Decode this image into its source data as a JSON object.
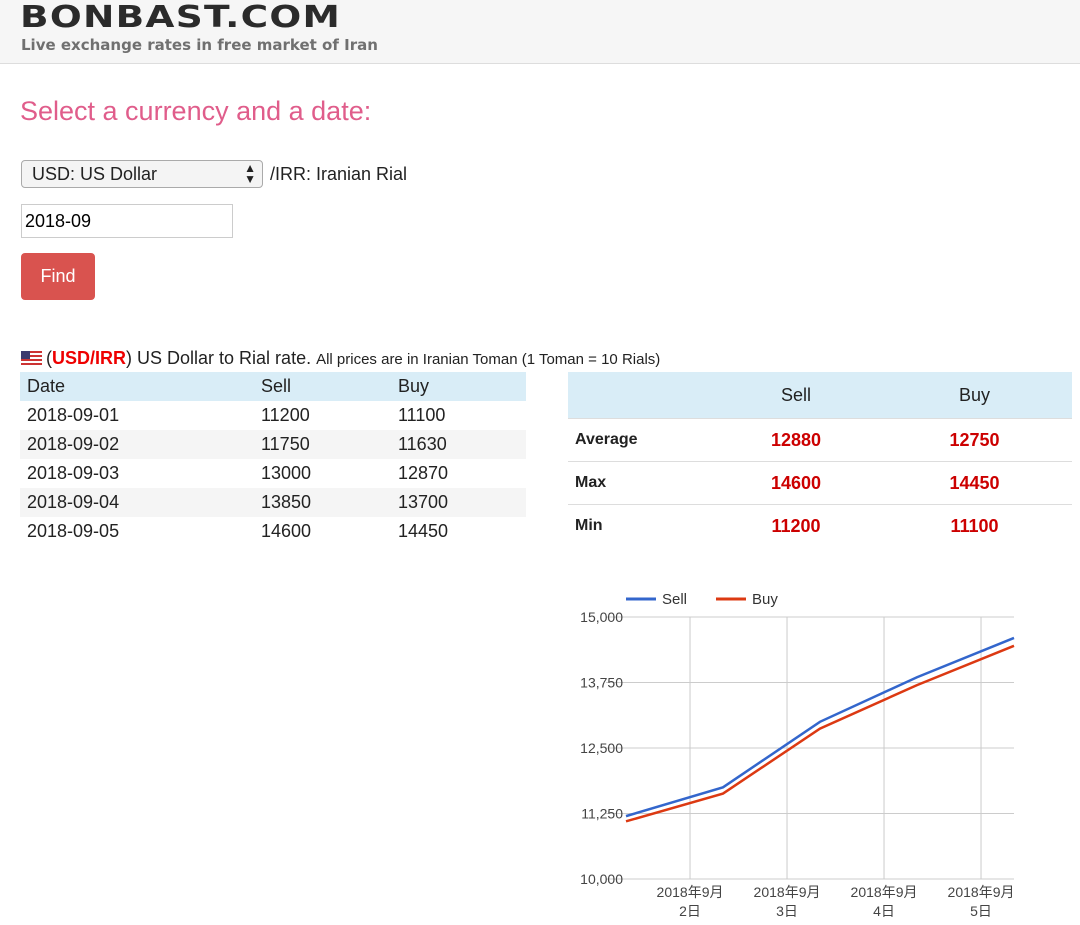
{
  "header": {
    "logo": "BONBAST.COM",
    "tagline": "Live exchange rates in free market of Iran"
  },
  "form": {
    "title": "Select a currency and a date:",
    "currency": "USD: US Dollar",
    "pair_suffix": "/IRR: Iranian Rial",
    "date_value": "2018-09",
    "find_label": "Find"
  },
  "caption": {
    "open": "(",
    "code": "USD/IRR",
    "close": ")",
    "text": " US Dollar to Rial rate. ",
    "note": "All prices are in Iranian Toman (1 Toman = 10 Rials)"
  },
  "rates": {
    "headers": [
      "Date",
      "Sell",
      "Buy"
    ],
    "rows": [
      [
        "2018-09-01",
        "11200",
        "11100"
      ],
      [
        "2018-09-02",
        "11750",
        "11630"
      ],
      [
        "2018-09-03",
        "13000",
        "12870"
      ],
      [
        "2018-09-04",
        "13850",
        "13700"
      ],
      [
        "2018-09-05",
        "14600",
        "14450"
      ]
    ]
  },
  "stats": {
    "headers": [
      "",
      "Sell",
      "Buy"
    ],
    "rows": [
      [
        "Average",
        "12880",
        "12750"
      ],
      [
        "Max",
        "14600",
        "14450"
      ],
      [
        "Min",
        "11200",
        "11100"
      ]
    ]
  },
  "chart_data": {
    "type": "line",
    "x": [
      "2018-09-01",
      "2018-09-02",
      "2018-09-03",
      "2018-09-04",
      "2018-09-05"
    ],
    "series": [
      {
        "name": "Sell",
        "color": "#3366cc",
        "values": [
          11200,
          11750,
          13000,
          13850,
          14600
        ]
      },
      {
        "name": "Buy",
        "color": "#dc3912",
        "values": [
          11100,
          11630,
          12870,
          13700,
          14450
        ]
      }
    ],
    "ylim": [
      10000,
      15000
    ],
    "yticks": [
      "10,000",
      "11,250",
      "12,500",
      "13,750",
      "15,000"
    ],
    "ytick_values": [
      10000,
      11250,
      12500,
      13750,
      15000
    ],
    "xticks": [
      [
        "2018年9月",
        "2日"
      ],
      [
        "2018年9月",
        "3日"
      ],
      [
        "2018年9月",
        "4日"
      ],
      [
        "2018年9月",
        "5日"
      ]
    ],
    "legend": "top-left",
    "grid": true
  }
}
